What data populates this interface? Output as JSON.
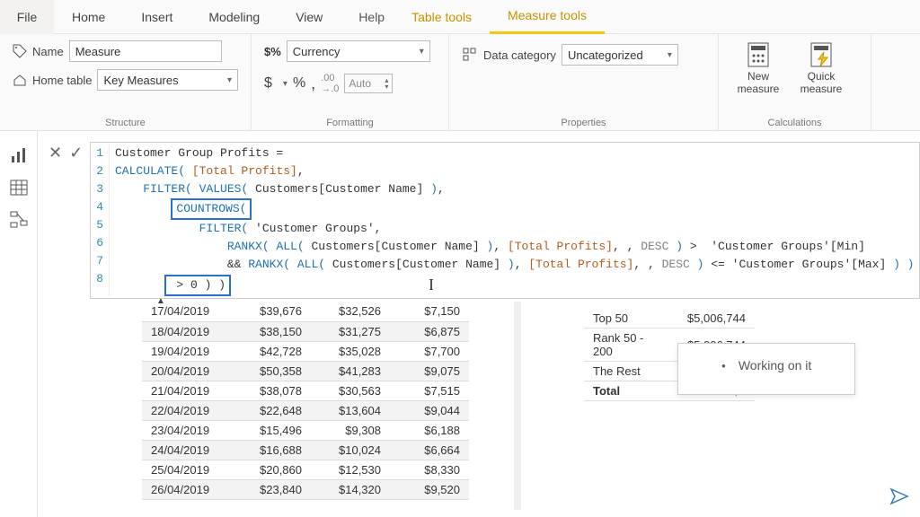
{
  "tabs": {
    "file": "File",
    "home": "Home",
    "insert": "Insert",
    "modeling": "Modeling",
    "view": "View",
    "help": "Help",
    "tabletools": "Table tools",
    "measuretools": "Measure tools"
  },
  "ribbon": {
    "structure": {
      "name_label": "Name",
      "name_value": "Measure",
      "hometable_label": "Home table",
      "hometable_value": "Key Measures",
      "group_label": "Structure"
    },
    "formatting": {
      "format_value": "Currency",
      "precision_placeholder": "Auto",
      "symbol": "$",
      "percent": "%",
      "comma": ",",
      "dec_inc": ".00",
      "group_label": "Formatting"
    },
    "properties": {
      "datacat_label": "Data category",
      "datacat_value": "Uncategorized",
      "group_label": "Properties"
    },
    "calculations": {
      "newmeasure": "New measure",
      "quickmeasure": "Quick measure",
      "group_label": "Calculations"
    }
  },
  "formula": {
    "line1": "Customer Group Profits =",
    "countrows": "COUNTROWS(",
    "gtzero": " > 0 ) )"
  },
  "left_table": {
    "rows": [
      {
        "date": "17/04/2019",
        "c1": "$39,676",
        "c2": "$32,526",
        "c3": "$7,150"
      },
      {
        "date": "18/04/2019",
        "c1": "$38,150",
        "c2": "$31,275",
        "c3": "$6,875"
      },
      {
        "date": "19/04/2019",
        "c1": "$42,728",
        "c2": "$35,028",
        "c3": "$7,700"
      },
      {
        "date": "20/04/2019",
        "c1": "$50,358",
        "c2": "$41,283",
        "c3": "$9,075"
      },
      {
        "date": "21/04/2019",
        "c1": "$38,078",
        "c2": "$30,563",
        "c3": "$7,515"
      },
      {
        "date": "22/04/2019",
        "c1": "$22,648",
        "c2": "$13,604",
        "c3": "$9,044"
      },
      {
        "date": "23/04/2019",
        "c1": "$15,496",
        "c2": "$9,308",
        "c3": "$6,188"
      },
      {
        "date": "24/04/2019",
        "c1": "$16,688",
        "c2": "$10,024",
        "c3": "$6,664"
      },
      {
        "date": "25/04/2019",
        "c1": "$20,860",
        "c2": "$12,530",
        "c3": "$8,330"
      },
      {
        "date": "26/04/2019",
        "c1": "$23,840",
        "c2": "$14,320",
        "c3": "$9,520"
      }
    ]
  },
  "right_table": {
    "rows": [
      {
        "label": "Top 50",
        "value": "$5,006,744"
      },
      {
        "label": "Rank 50 - 200",
        "value": "$5,006,744"
      },
      {
        "label": "The Rest",
        "value": "$"
      },
      {
        "label": "Total",
        "value": "$5"
      }
    ]
  },
  "tooltip": {
    "text": "Working on it"
  }
}
